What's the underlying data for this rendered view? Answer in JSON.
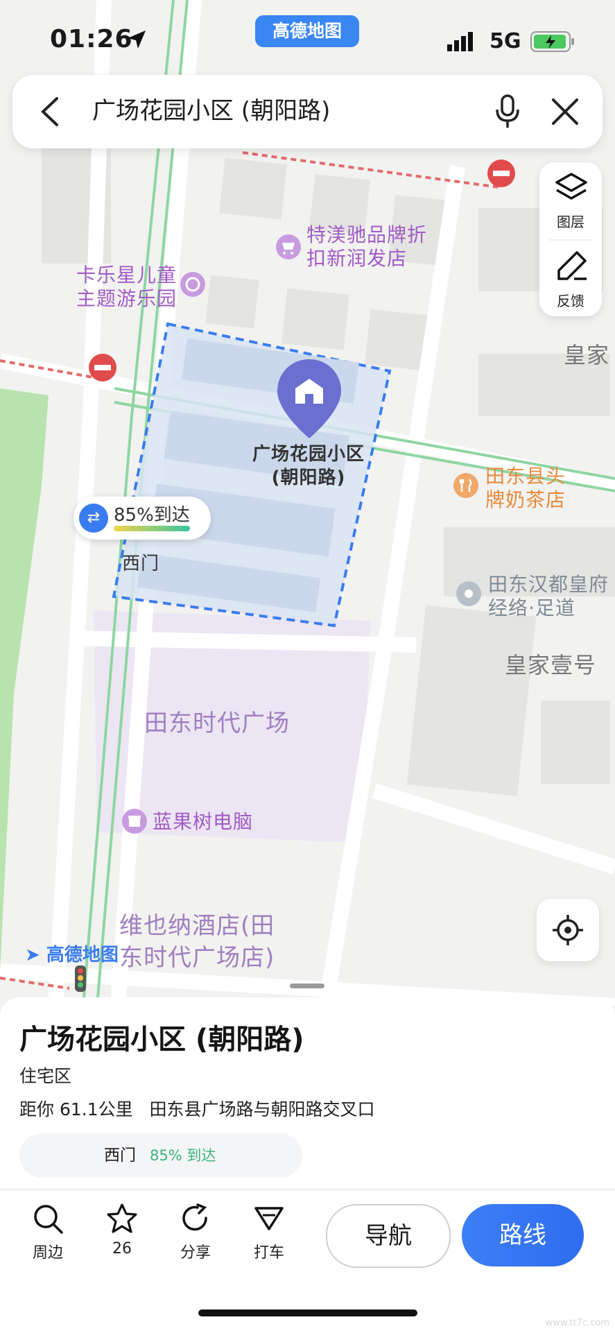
{
  "status_bar": {
    "time": "01:26",
    "network": "5G",
    "brand_label": "高德地图"
  },
  "search": {
    "query": "广场花园小区 (朝阳路)"
  },
  "map_controls": {
    "layers_label": "图层",
    "feedback_label": "反馈"
  },
  "map": {
    "labels": {
      "tejiao": "特渼驰品牌折\n扣新润发店",
      "kalexing": "卡乐星儿童\n主题游乐园",
      "huangjia": "皇家",
      "tiandong_tea": "田东县头\n牌奶茶店",
      "hanspa": "田东汉都皇府\n经络·足道",
      "huangjia_one": "皇家壹号",
      "square": "田东时代广场",
      "lanmei": "蓝果树电脑",
      "hotel": "维也纳酒店(田\n东时代广场店)",
      "selected_poi": "广场花园小区\n(朝阳路)",
      "west_gate": "西门",
      "arrival_badge": "85%到达",
      "logo": "高德地图"
    }
  },
  "poi": {
    "name": "广场花园小区 (朝阳路)",
    "category": "住宅区",
    "distance": "距你 61.1公里",
    "address": "田东县广场路与朝阳路交叉口",
    "entrance": {
      "name": "西门",
      "rate": "85% 到达"
    }
  },
  "toolbar": {
    "nearby": "周边",
    "favorite_count": "26",
    "share": "分享",
    "taxi": "打车",
    "navigate": "导航",
    "route": "路线"
  },
  "colors": {
    "accent": "#2f6cf0",
    "green_text": "#3bb37a",
    "poi_pin": "#6a6fd0"
  },
  "watermark": "www.tt7c.com"
}
